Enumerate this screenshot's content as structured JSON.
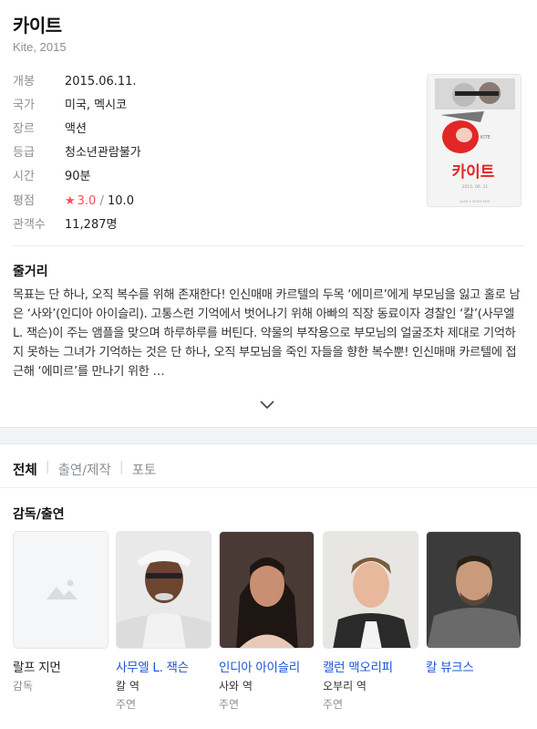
{
  "movie": {
    "title": "카이트",
    "subtitle": "Kite, 2015",
    "info": [
      {
        "label": "개봉",
        "value": "2015.06.11."
      },
      {
        "label": "국가",
        "value": "미국, 멕시코"
      },
      {
        "label": "장르",
        "value": "액션"
      },
      {
        "label": "등급",
        "value": "청소년관람불가"
      },
      {
        "label": "시간",
        "value": "90분"
      }
    ],
    "rating": {
      "label": "평점",
      "star": "★",
      "score": "3.0",
      "separator": "/",
      "max": "10.0"
    },
    "audience": {
      "label": "관객수",
      "value": "11,287명"
    },
    "poster": {
      "text": "카이트",
      "date": "2015. 06. 11",
      "tagline": "ALEX A ZIGGY EDIT"
    }
  },
  "plot": {
    "heading": "줄거리",
    "text": "목표는 단 하나, 오직 복수를 위해 존재한다! 인신매매 카르텔의 두목 ‘에미르’에게 부모님을 잃고 홀로 남은 ‘사와’(인디아 아이슬리). 고통스런 기억에서 벗어나기 위해 아빠의 직장 동료이자 경찰인 ‘칼’(사무엘 L. 잭슨)이 주는 앰플을 맞으며 하루하루를 버틴다. 약물의 부작용으로 부모님의 얼굴조차 제대로 기억하지 못하는 그녀가 기억하는 것은 단 하나, 오직 부모님을 죽인 자들을 향한 복수뿐! 인신매매 카르텔에 접근해 ‘에미르’를 만나기 위한 …"
  },
  "tabs": [
    "전체",
    "출연/제작",
    "포토"
  ],
  "cast_section": {
    "heading": "감독/출연",
    "people": [
      {
        "name": "랄프 지먼",
        "role": "감독",
        "type": ""
      },
      {
        "name": "사무엘 L. 잭슨",
        "role": "칼 역",
        "type": "주연"
      },
      {
        "name": "인디아 아이슬리",
        "role": "사와 역",
        "type": "주연"
      },
      {
        "name": "캘런 맥오리피",
        "role": "오부리 역",
        "type": "주연"
      },
      {
        "name": "칼 뷰크스",
        "role": "",
        "type": ""
      }
    ]
  },
  "colors": {
    "accent_link": "#1a55d8",
    "rating_red": "#ff4d4d",
    "muted": "#8a8f95"
  }
}
